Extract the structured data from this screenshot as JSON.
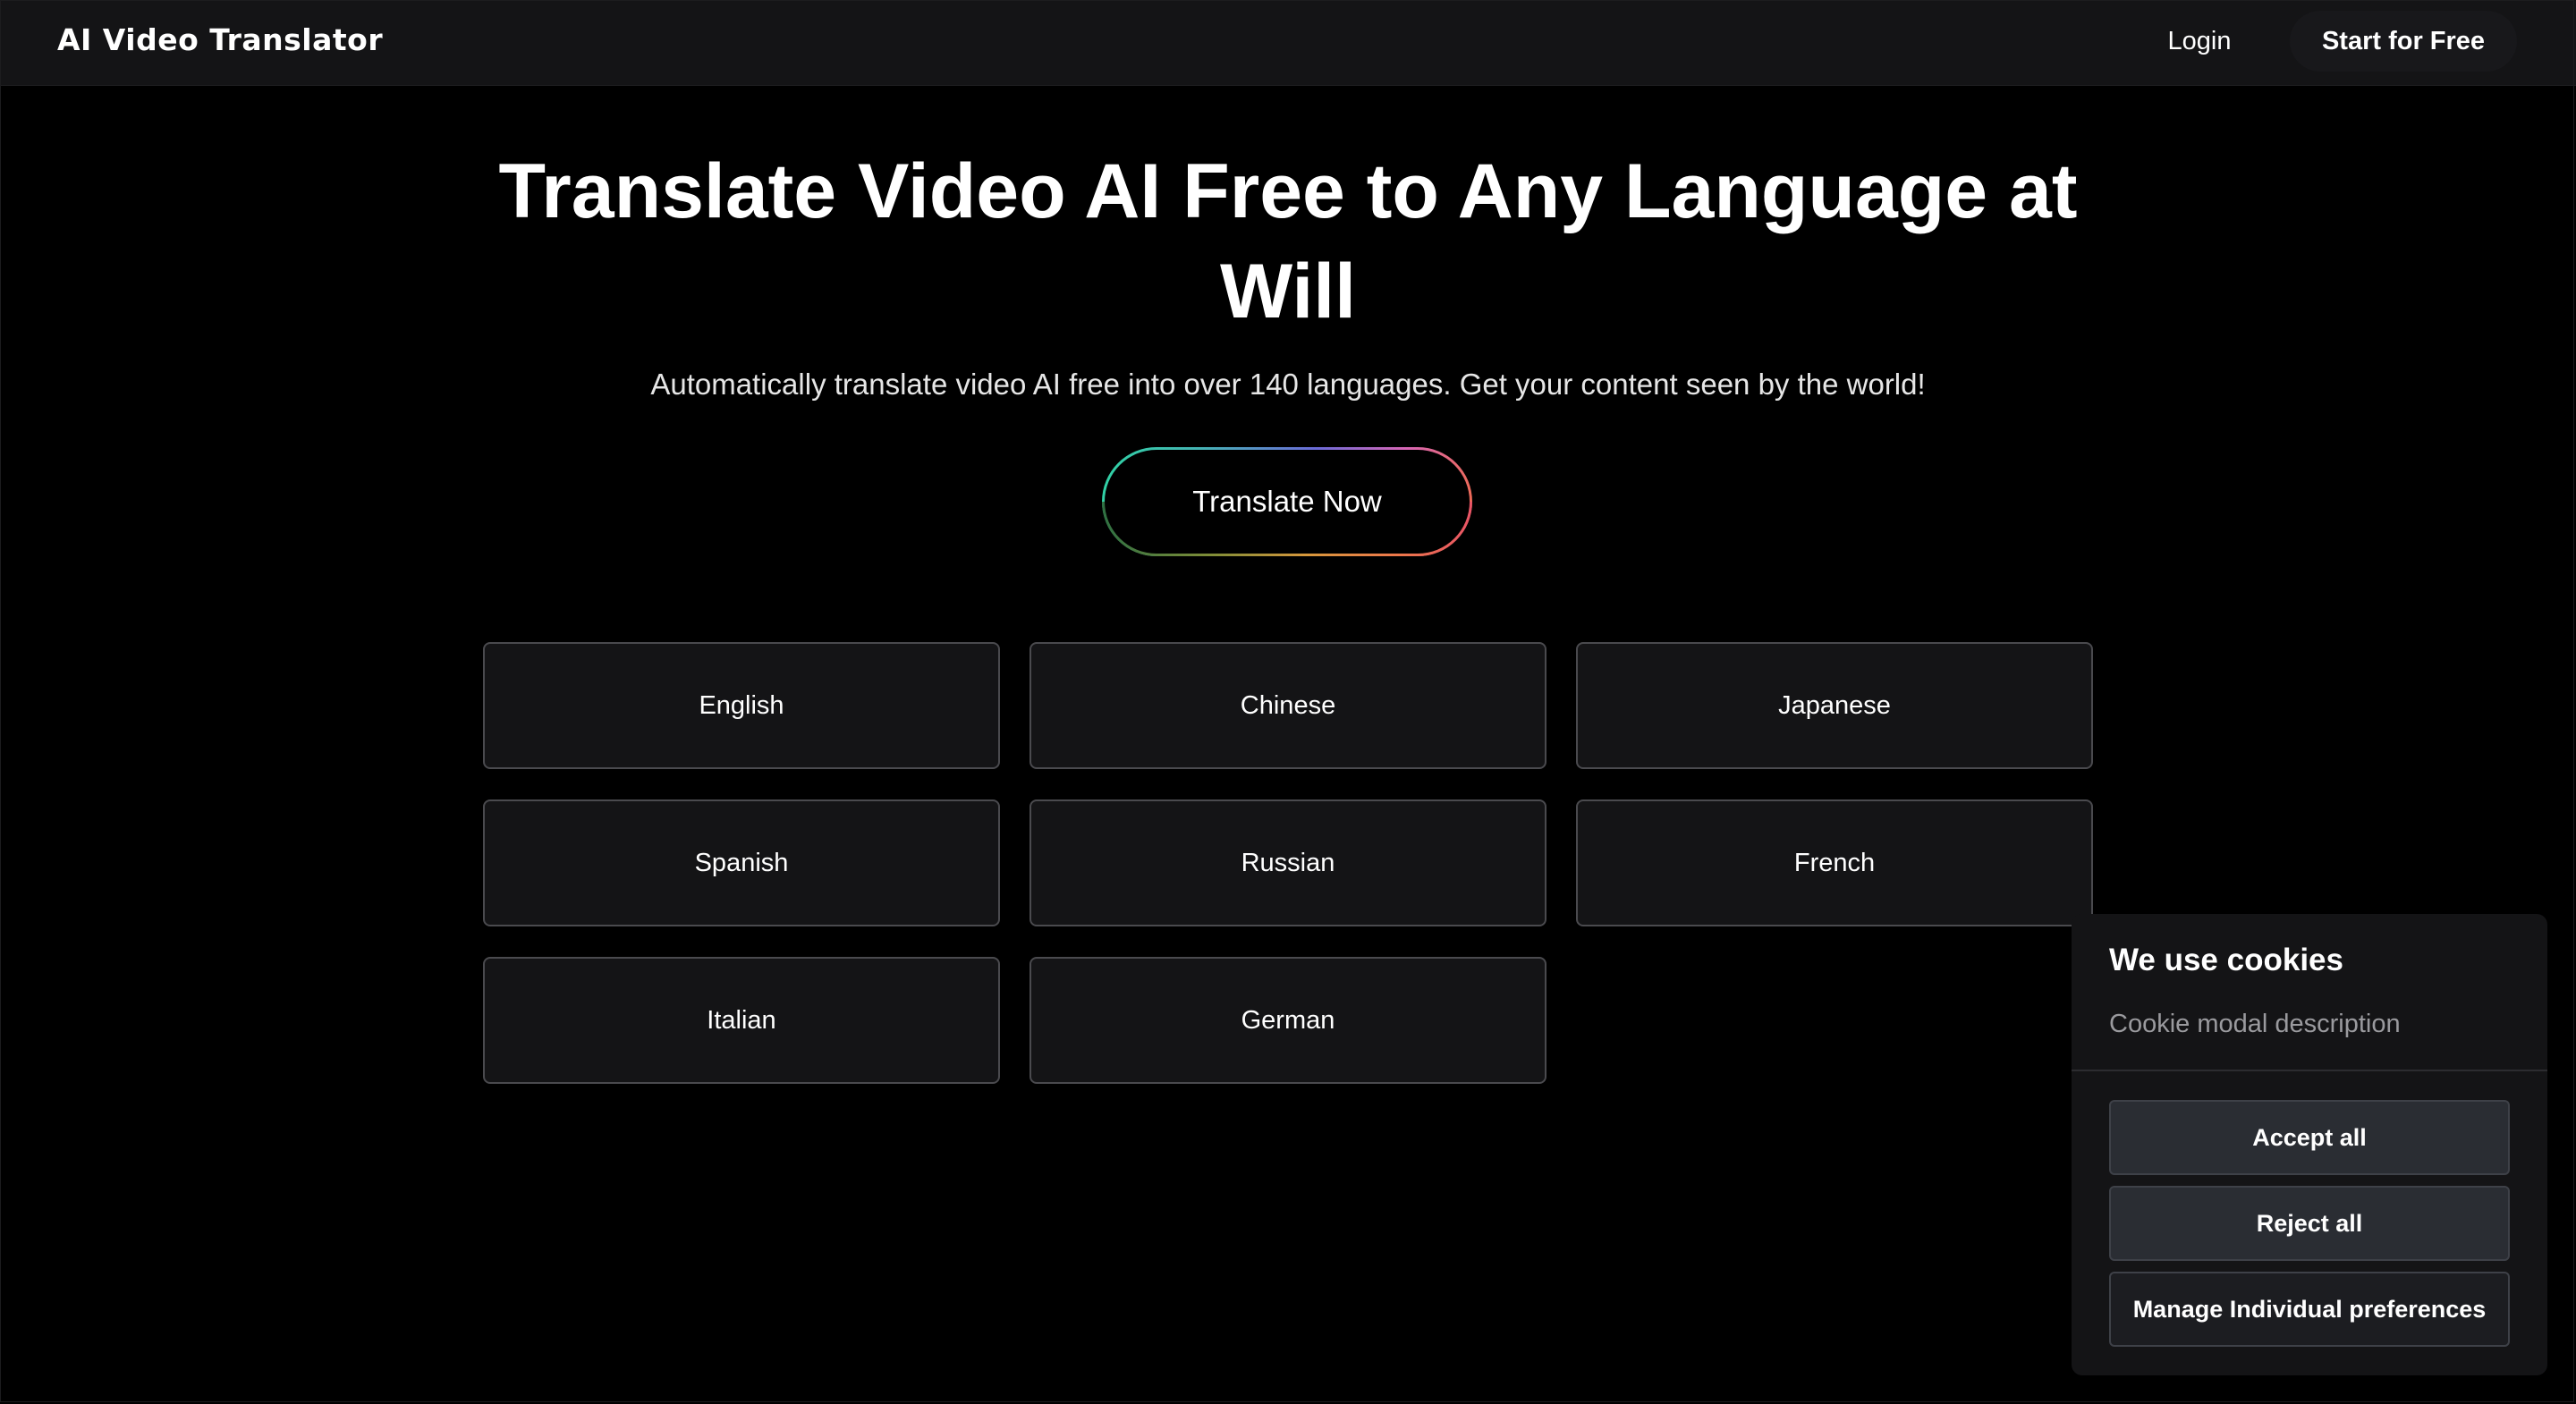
{
  "header": {
    "logo_text": "AI Video Translator",
    "login_label": "Login",
    "start_label": "Start for Free"
  },
  "hero": {
    "title": "Translate Video AI Free to Any Language at Will",
    "subtitle": "Automatically translate video AI free into over 140 languages. Get your content seen by the world!",
    "cta_label": "Translate Now"
  },
  "languages": [
    "English",
    "Chinese",
    "Japanese",
    "Spanish",
    "Russian",
    "French",
    "Italian",
    "German"
  ],
  "cookie": {
    "title": "We use cookies",
    "description": "Cookie modal description",
    "accept_label": "Accept all",
    "reject_label": "Reject all",
    "manage_label": "Manage Individual preferences"
  },
  "colors": {
    "background": "#000000",
    "header_bg": "#141416",
    "card_bg": "#141416",
    "card_border": "#4a4a4e",
    "cookie_button_bg": "#2a2d33",
    "cta_gradient": [
      "#2fd3a4",
      "#6b6bd8",
      "#d766b6",
      "#f06a4a",
      "#e8a020"
    ]
  }
}
